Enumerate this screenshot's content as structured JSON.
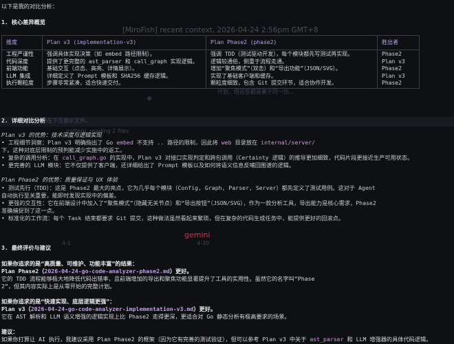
{
  "intro": "以下是我的对比分析：",
  "section1": {
    "title": "1. 核心差异概览",
    "table": {
      "headers": [
        "维度",
        "Plan v3 (implementation-v3)",
        "Plan Phase2 (phase2)",
        "胜出者"
      ],
      "dimensions": [
        "工程严谨性",
        "代码深度",
        "前端功能",
        "LLM 集成",
        "执行颗粒度"
      ],
      "v3_lines": [
        "强调具体实现决策（如 embed 路径限制）。",
        "提供了更完整的 ast_parser 和 call_graph 实现逻辑。",
        "基础交互（点击、高亮、详情展示）。",
        "详细定义了 Prompt 模板和 SHA256 缓存逻辑。",
        "步骤非常紧凑，适合快速交付。"
      ],
      "phase2_lines": [
        "强调 TDD（测试驱动开发），每个模块都先写测试再实现。",
        "逻辑较通俗，侧重于流程走通。",
        "增加“聚焦模式”（双击）和“导出功能”（JSON/SVG）。",
        "实现了基础客户端和缓存。",
        "颗粒度细致，包含 Git 提交环节，适合协作开发。"
      ],
      "winners": [
        "Phase2",
        "Plan v3",
        "Phase2",
        "Plan v3",
        "Phase2"
      ]
    }
  },
  "section2": {
    "title": "2. 详细对比分析",
    "v3_heading": "Plan v3 的优势：技术深度与逻辑实现",
    "v3_items": [
      [
        "• 工程细节洞察：Plan v3 明确指出了 Go ",
        "embed",
        " 不支持 .. 路径的限制，因此将 ",
        "web",
        " 目录放在 ",
        "internal/server/"
      ],
      [
        "  下。这种对底层限制的预判能减少实施中的返工。"
      ],
      [
        "• 复杂的调用分析：在 ",
        "call_graph.go",
        " 的实现中，Plan v3 对接口实现判定和跨包调用（Certainty 逻辑）的推导更加细致，代码片段更接近生产可用状态。"
      ],
      [
        "• 更完善的 LLM 模块：它不仅提供了客户端，还详细给出了 Prompt 模板以及如何将语义信息反哺回图谱的逻辑。"
      ]
    ],
    "phase2_heading": "Plan Phase2 的优势：质量保证与 UX 体验",
    "phase2_items": [
      [
        "• 测试先行（TDD）：这是 Phase2 最大的亮点，它为几乎每个模块（Config, Graph, Parser, Server）都先定义了测试用例。这对于 Agent"
      ],
      [
        "  自动执行至关重要，能即时发现实现中的偏差。"
      ],
      [
        "• 更强的交互性：它在前端设计中加入了“聚焦模式”（隐藏无关节点）和“导出按钮”（JSON/SVG），作为一款分析工具，导出能力是核心需求，Phase2"
      ],
      [
        "  准确捕捉到了这一点。"
      ],
      [
        "• 标准化的工作流：每个 Task 结束都要求 Git 提交，这种做法虽然看起来繁琐，但在复杂的代码生成任务中，能提供更好的回滚点。"
      ]
    ]
  },
  "section3": {
    "title": "3. 最终评价与建议",
    "q1": "如果你追求的是“高质量、可维护、功能丰富”的结果：",
    "a1_pre": "Plan Phase2（",
    "a1_link": "2026-04-24-go-code-analyzer-phase2.md",
    "a1_post": "）更好。",
    "a1_body1": "它的 TDD 流程能够极大地降低代码出错率，且前端增加的导出和聚焦功能显著提升了工具的实用性。虽然它的名字叫“Phase",
    "a1_body2": "2”，但其内容实际上是从零开始的完整计划。",
    "q2": "如果你追求的是“快速实现、底层逻辑更强”：",
    "a2_pre": "Plan v3（",
    "a2_link": "2026-04-24-go-code-analyzer-implementation-v3.md",
    "a2_post": "）更好。",
    "a2_body": "它在 AST 解析和 LLM 语义增强的逻辑实现上比 Phase2 走得更深，更适合对 Go 静态分析有极高要求的场景。",
    "advice_label": "建议：",
    "advice_pre": "如果你打算让 AI 执行，我建议采用 Plan Phase2 的框架（因为它有完善的测试验证），但可以参考 Plan v3 中关于 ",
    "advice_code1": "ast_parser",
    "advice_mid": " 和 LLM 增强器的具体代码逻辑。"
  },
  "background": {
    "context_banner": "[MiroFish] recent context, 2026-04-24 2:56pm GMT+8",
    "faded_note": "完整计划在下方展示文件。",
    "faded_reading": "pattern, reading 2 files",
    "faded_mid": "计划，但这些都是基于同一份...",
    "tick_left": "4-1",
    "tick_right": "4-30",
    "logo_text": "gemini"
  },
  "colors": {
    "background": "#0f1014",
    "text": "#d7d9de",
    "code": "#d49be0",
    "link": "#c6a0e6",
    "header": "#b7a6e8"
  }
}
